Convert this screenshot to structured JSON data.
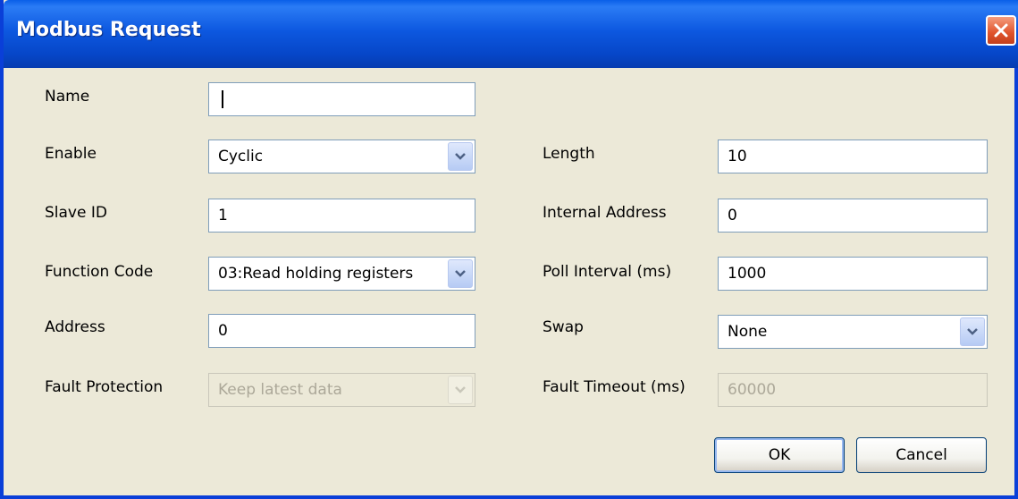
{
  "window": {
    "title": "Modbus Request"
  },
  "fields": {
    "name": {
      "label": "Name",
      "value": ""
    },
    "enable": {
      "label": "Enable",
      "value": "Cyclic"
    },
    "slave_id": {
      "label": "Slave ID",
      "value": "1"
    },
    "function_code": {
      "label": "Function Code",
      "value": "03:Read holding registers"
    },
    "address": {
      "label": "Address",
      "value": "0"
    },
    "fault_protection": {
      "label": "Fault Protection",
      "value": "Keep latest data"
    },
    "length": {
      "label": "Length",
      "value": "10"
    },
    "internal_address": {
      "label": "Internal Address",
      "value": "0"
    },
    "poll_interval": {
      "label": "Poll Interval (ms)",
      "value": "1000"
    },
    "swap": {
      "label": "Swap",
      "value": "None"
    },
    "fault_timeout": {
      "label": "Fault Timeout (ms)",
      "value": "60000"
    }
  },
  "buttons": {
    "ok": "OK",
    "cancel": "Cancel"
  },
  "icons": {
    "close": "close-icon",
    "dropdown": "chevron-down-icon"
  },
  "colors": {
    "titlebar": "#0a4fd8",
    "close_button": "#e0532b",
    "dialog_bg": "#ece9d8"
  }
}
